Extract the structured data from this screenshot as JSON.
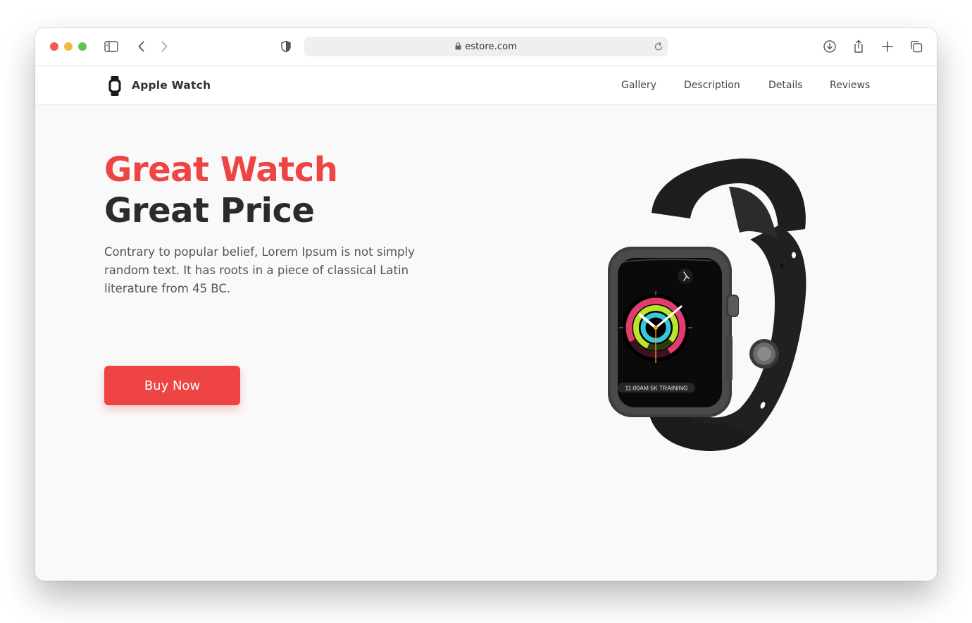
{
  "browser": {
    "url": "estore.com",
    "icons": {
      "sidebar": "sidebar-icon",
      "back": "chevron-left-icon",
      "forward": "chevron-right-icon",
      "shield": "shield-icon",
      "lock": "lock-icon",
      "reload": "reload-icon",
      "download": "download-icon",
      "share": "share-icon",
      "new_tab": "plus-icon",
      "tabs": "tabs-icon"
    }
  },
  "site": {
    "brand": "Apple Watch",
    "brand_icon": "watch-icon",
    "nav": [
      "Gallery",
      "Description",
      "Details",
      "Reviews"
    ]
  },
  "hero": {
    "title_line1": "Great Watch",
    "title_line2": "Great Price",
    "description": "Contrary to popular belief, Lorem Ipsum is not simply random text. It has roots in a piece of classical Latin literature from 45 BC.",
    "cta": "Buy Now",
    "watch_screen_text": "11:00AM 5K TRAINING"
  },
  "colors": {
    "accent": "#ef4444",
    "title_dark": "#2b2b2b",
    "body_text": "#555555",
    "page_bg": "#f9f9f9"
  }
}
